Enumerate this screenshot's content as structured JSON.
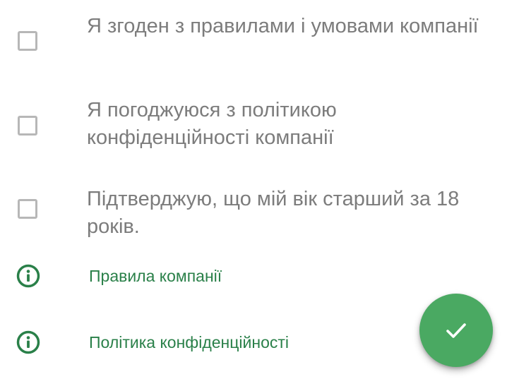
{
  "consents": [
    {
      "label": "Я згоден з правилами і умовами компанії",
      "checked": false
    },
    {
      "label": "Я погоджуюся з політикою конфіденційності компанії",
      "checked": false
    },
    {
      "label": "Підтверджую, що мій вік старший за 18 років.",
      "checked": false
    }
  ],
  "links": [
    {
      "label": "Правила компанії",
      "icon": "info-icon"
    },
    {
      "label": "Політика конфіденційності",
      "icon": "info-icon"
    }
  ],
  "fab": {
    "icon": "check-icon"
  },
  "colors": {
    "accent": "#2a8049",
    "fab": "#4aa962",
    "checkbox_border": "#b7b7b7",
    "text": "#7c7c7c"
  }
}
